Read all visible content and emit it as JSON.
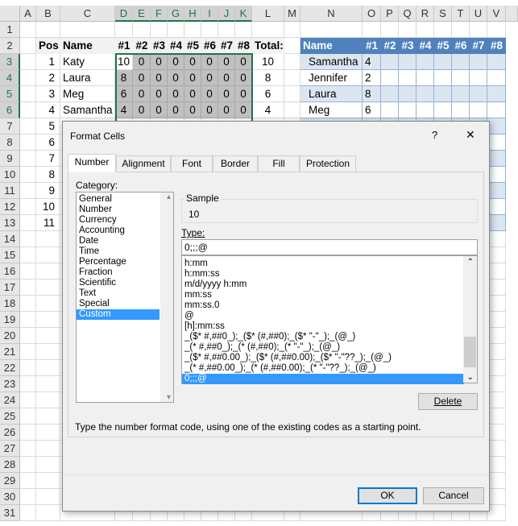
{
  "columns": [
    "A",
    "B",
    "C",
    "D",
    "E",
    "F",
    "G",
    "H",
    "I",
    "J",
    "K",
    "L",
    "M",
    "N",
    "O",
    "P",
    "Q",
    "R",
    "S",
    "T",
    "U",
    "V"
  ],
  "rows": [
    "1",
    "2",
    "3",
    "4",
    "5",
    "6",
    "7",
    "8",
    "9",
    "10",
    "11",
    "12",
    "13",
    "14",
    "15",
    "16",
    "17",
    "18",
    "19",
    "20",
    "21",
    "22",
    "23",
    "24",
    "25",
    "26",
    "27",
    "28",
    "29",
    "30",
    "31"
  ],
  "left_table": {
    "headers": [
      "Pos",
      "Name",
      "#1",
      "#2",
      "#3",
      "#4",
      "#5",
      "#6",
      "#7",
      "#8",
      "Total:"
    ],
    "rows": [
      [
        "1",
        "Katy",
        "10",
        "0",
        "0",
        "0",
        "0",
        "0",
        "0",
        "0",
        "10"
      ],
      [
        "2",
        "Laura",
        "8",
        "0",
        "0",
        "0",
        "0",
        "0",
        "0",
        "0",
        "8"
      ],
      [
        "3",
        "Meg",
        "6",
        "0",
        "0",
        "0",
        "0",
        "0",
        "0",
        "0",
        "6"
      ],
      [
        "4",
        "Samantha",
        "4",
        "0",
        "0",
        "0",
        "0",
        "0",
        "0",
        "0",
        "4"
      ]
    ],
    "pos_more": [
      "5",
      "6",
      "7",
      "8",
      "9",
      "10",
      "11"
    ]
  },
  "right_table": {
    "headers": [
      "Name",
      "#1",
      "#2",
      "#3",
      "#4",
      "#5",
      "#6",
      "#7",
      "#8"
    ],
    "rows": [
      [
        "Samantha",
        "4"
      ],
      [
        "Jennifer",
        "2"
      ],
      [
        "Laura",
        "8"
      ],
      [
        "Meg",
        "6"
      ]
    ],
    "header_color": "#4f81bd",
    "stripe_color": "#dce6f1"
  },
  "dialog": {
    "title": "Format Cells",
    "help": "?",
    "close": "✕",
    "tabs": [
      "Number",
      "Alignment",
      "Font",
      "Border",
      "Fill",
      "Protection"
    ],
    "active_tab": "Number",
    "category_label": "Category:",
    "categories": [
      "General",
      "Number",
      "Currency",
      "Accounting",
      "Date",
      "Time",
      "Percentage",
      "Fraction",
      "Scientific",
      "Text",
      "Special",
      "Custom"
    ],
    "selected_category": "Custom",
    "sample_label": "Sample",
    "sample_value": "10",
    "type_label": "Type:",
    "type_value": "0;;;@",
    "formats": [
      "h:mm",
      "h:mm:ss",
      "m/d/yyyy h:mm",
      "mm:ss",
      "mm:ss.0",
      "@",
      "[h]:mm:ss",
      "_($* #,##0_);_($* (#,##0);_($* \"-\"_);_(@_)",
      "_(* #,##0_);_(* (#,##0);_(* \"-\"_);_(@_)",
      "_($* #,##0.00_);_($* (#,##0.00);_($* \"-\"??_);_(@_)",
      "_(* #,##0.00_);_(* (#,##0.00);_(* \"-\"??_);_(@_)",
      "0;;;@"
    ],
    "selected_format": "0;;;@",
    "delete": "Delete",
    "description": "Type the number format code, using one of the existing codes as a starting point.",
    "ok": "OK",
    "cancel": "Cancel"
  }
}
